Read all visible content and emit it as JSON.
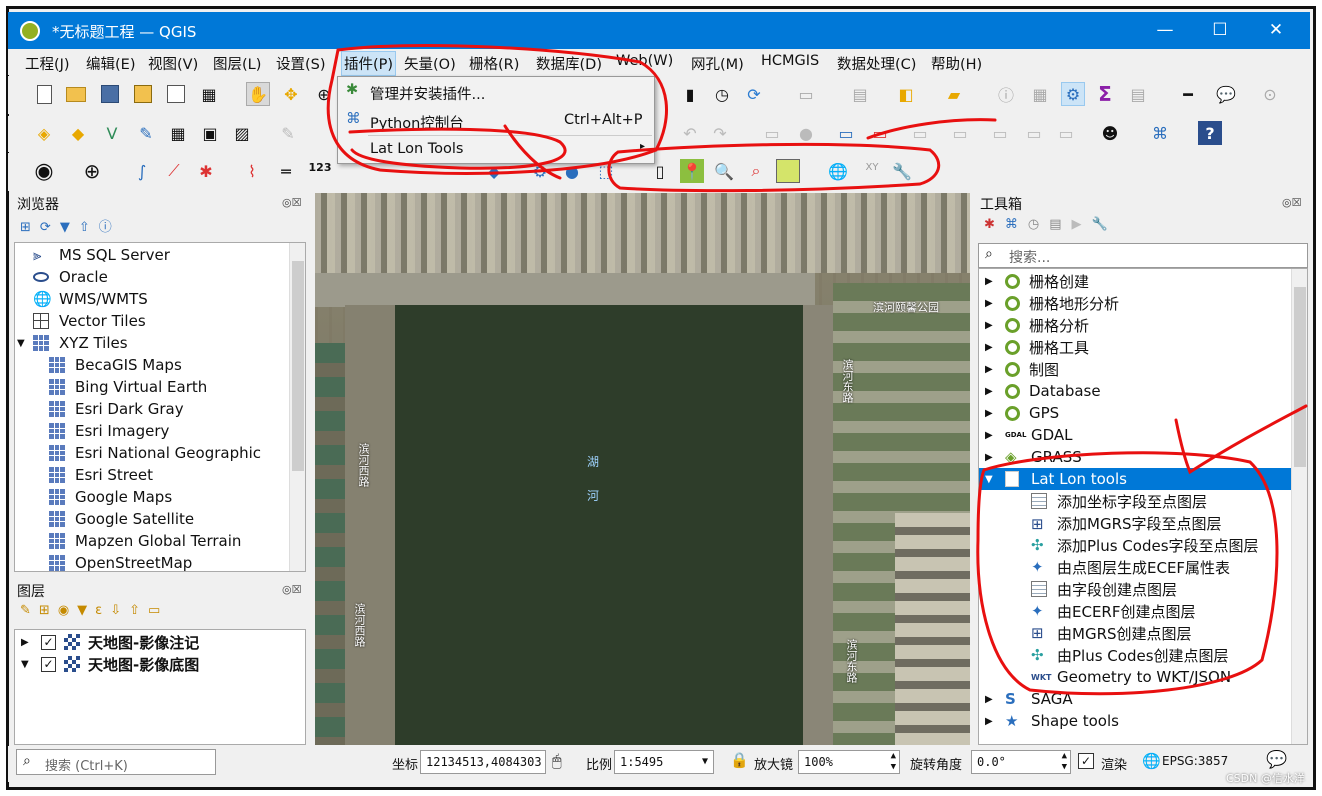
{
  "window": {
    "title": "*无标题工程 — QGIS",
    "minimize": "—",
    "maximize": "☐",
    "close": "✕"
  },
  "menu": [
    "工程(J)",
    "编辑(E)",
    "视图(V)",
    "图层(L)",
    "设置(S)",
    "插件(P)",
    "矢量(O)",
    "栅格(R)",
    "数据库(D)",
    "Web(W)",
    "网孔(M)",
    "HCMGIS",
    "数据处理(C)",
    "帮助(H)"
  ],
  "plugin_menu": {
    "items": [
      {
        "label": "管理并安装插件...",
        "shortcut": ""
      },
      {
        "label": "Python控制台",
        "shortcut": "Ctrl+Alt+P"
      },
      {
        "label": "Lat Lon Tools",
        "shortcut": "▸"
      }
    ]
  },
  "toolbar_text": {
    "numeric": "123",
    "xy": "XY"
  },
  "browser": {
    "title": "浏览器",
    "panel_buttons": "◎☒",
    "items": [
      {
        "label": "MS SQL Server",
        "icon": "mssql-icon",
        "level": 0
      },
      {
        "label": "Oracle",
        "icon": "oracle-icon",
        "level": 0
      },
      {
        "label": "WMS/WMTS",
        "icon": "globe-icon",
        "level": 0
      },
      {
        "label": "Vector Tiles",
        "icon": "vector-tiles-icon",
        "level": 0
      },
      {
        "label": "XYZ Tiles",
        "icon": "xyz-tiles-icon",
        "level": 0,
        "expanded": "▼"
      },
      {
        "label": "BecaGIS Maps",
        "icon": "tile-icon",
        "level": 1
      },
      {
        "label": "Bing Virtual Earth",
        "icon": "tile-icon",
        "level": 1
      },
      {
        "label": "Esri Dark Gray",
        "icon": "tile-icon",
        "level": 1
      },
      {
        "label": "Esri Imagery",
        "icon": "tile-icon",
        "level": 1
      },
      {
        "label": "Esri National Geographic",
        "icon": "tile-icon",
        "level": 1
      },
      {
        "label": "Esri Street",
        "icon": "tile-icon",
        "level": 1
      },
      {
        "label": "Google Maps",
        "icon": "tile-icon",
        "level": 1
      },
      {
        "label": "Google Satellite",
        "icon": "tile-icon",
        "level": 1
      },
      {
        "label": "Mapzen Global Terrain",
        "icon": "tile-icon",
        "level": 1
      },
      {
        "label": "OpenStreetMap",
        "icon": "tile-icon",
        "level": 1
      }
    ]
  },
  "layers": {
    "title": "图层",
    "panel_buttons": "◎☒",
    "items": [
      {
        "label": "天地图-影像注记",
        "checked": "✓",
        "arrow": "▶"
      },
      {
        "label": "天地图-影像底图",
        "checked": "✓",
        "arrow": "▼"
      }
    ]
  },
  "map": {
    "labels": [
      "滨河西路",
      "滨河西路",
      "滨河东路",
      "滨河东路",
      "滨河颐馨公园"
    ],
    "lake_text": [
      "湖",
      "河"
    ]
  },
  "toolbox": {
    "title": "工具箱",
    "panel_buttons": "◎☒",
    "search_placeholder": "搜索...",
    "groups": [
      {
        "label": "栅格创建",
        "icon": "qgis-icon"
      },
      {
        "label": "栅格地形分析",
        "icon": "qgis-icon"
      },
      {
        "label": "栅格分析",
        "icon": "qgis-icon"
      },
      {
        "label": "栅格工具",
        "icon": "qgis-icon"
      },
      {
        "label": "制图",
        "icon": "qgis-icon"
      },
      {
        "label": "Database",
        "icon": "qgis-icon"
      },
      {
        "label": "GPS",
        "icon": "qgis-icon"
      },
      {
        "label": "GDAL",
        "icon": "gdal-icon"
      },
      {
        "label": "GRASS",
        "icon": "grass-icon"
      }
    ],
    "latlon": {
      "label": "Lat Lon tools",
      "tools": [
        {
          "label": "添加坐标字段至点图层",
          "icon": "table-icon"
        },
        {
          "label": "添加MGRS字段至点图层",
          "icon": "grid-icon"
        },
        {
          "label": "添加Plus Codes字段至点图层",
          "icon": "plus-codes-icon"
        },
        {
          "label": "由点图层生成ECEF属性表",
          "icon": "ecef-icon"
        },
        {
          "label": "由字段创建点图层",
          "icon": "table-icon"
        },
        {
          "label": "由ECERF创建点图层",
          "icon": "ecef-icon"
        },
        {
          "label": "由MGRS创建点图层",
          "icon": "grid-icon"
        },
        {
          "label": "由Plus Codes创建点图层",
          "icon": "plus-codes-icon"
        },
        {
          "label": "Geometry to WKT/JSON",
          "icon": "wkt-icon"
        }
      ]
    },
    "after": [
      {
        "label": "SAGA",
        "icon": "saga-icon"
      },
      {
        "label": "Shape tools",
        "icon": "shape-tools-icon"
      }
    ],
    "gdal_tag": "GDAL",
    "wkt_tag": "WKT"
  },
  "statusbar": {
    "search_placeholder": "搜索 (Ctrl+K)",
    "coord_label": "坐标",
    "coord_value": "12134513,4084303",
    "scale_label": "比例",
    "scale_value": "1:5495",
    "magnifier_label": "放大镜",
    "magnifier_value": "100%",
    "rotation_label": "旋转角度",
    "rotation_value": "0.0°",
    "render_label": "渲染",
    "render_checked": "✓",
    "epsg": "EPSG:3857",
    "watermark": "CSDN @信水洋"
  },
  "colors": {
    "titlebar": "#0078d7",
    "selection": "#0078d7",
    "annotation_red": "#e81010",
    "lake": "#2e3d2a",
    "qgis_green": "#6aa02a"
  }
}
